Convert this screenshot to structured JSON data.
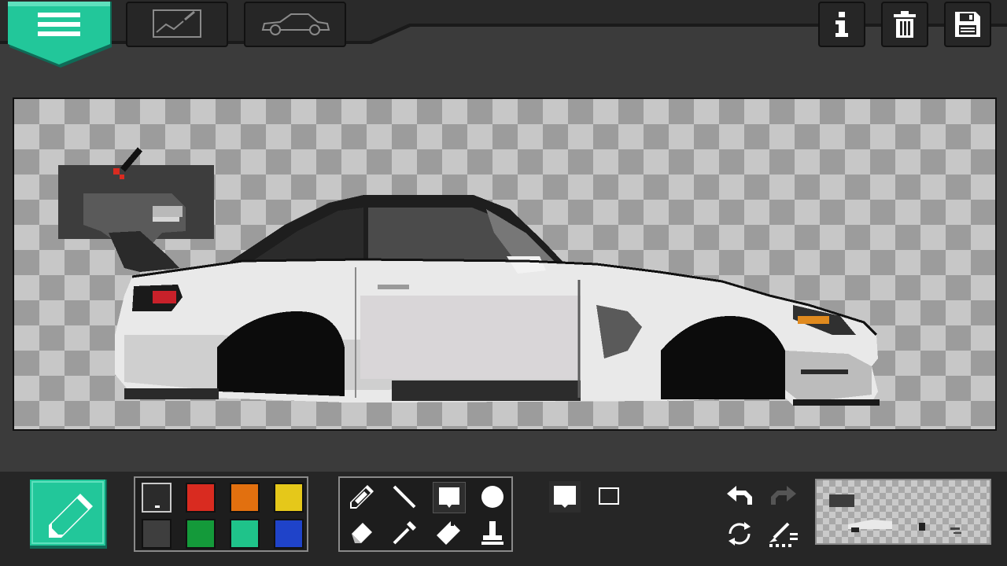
{
  "toolbar": {
    "menu_icon": "hamburger-menu-icon",
    "background_tab_icon": "image-sketch-icon",
    "car_tab_icon": "car-outline-icon",
    "info_icon": "info-icon",
    "delete_icon": "trash-icon",
    "save_icon": "floppy-disk-icon"
  },
  "palette": {
    "colors": [
      "#2b2b2b",
      "#d92b20",
      "#e2700f",
      "#e5c81a",
      "#3e3e3e",
      "#149a3a",
      "#1fc38a",
      "#1f43c9"
    ],
    "selected_index": 0
  },
  "tools": {
    "items": [
      "pencil-icon",
      "line-icon",
      "fill-rect-icon",
      "circle-icon",
      "eraser-icon",
      "eyedropper-icon",
      "bucket-icon",
      "stamp-icon"
    ],
    "selected_index": 2
  },
  "accent": "#22c79a",
  "car_colors": {
    "body": "#e9e9e9",
    "shadow": "#b9b9b9",
    "dark": "#111111",
    "glass": "#3a3a3a",
    "taillight": "#c8212a",
    "headlight": "#e08a1e"
  }
}
